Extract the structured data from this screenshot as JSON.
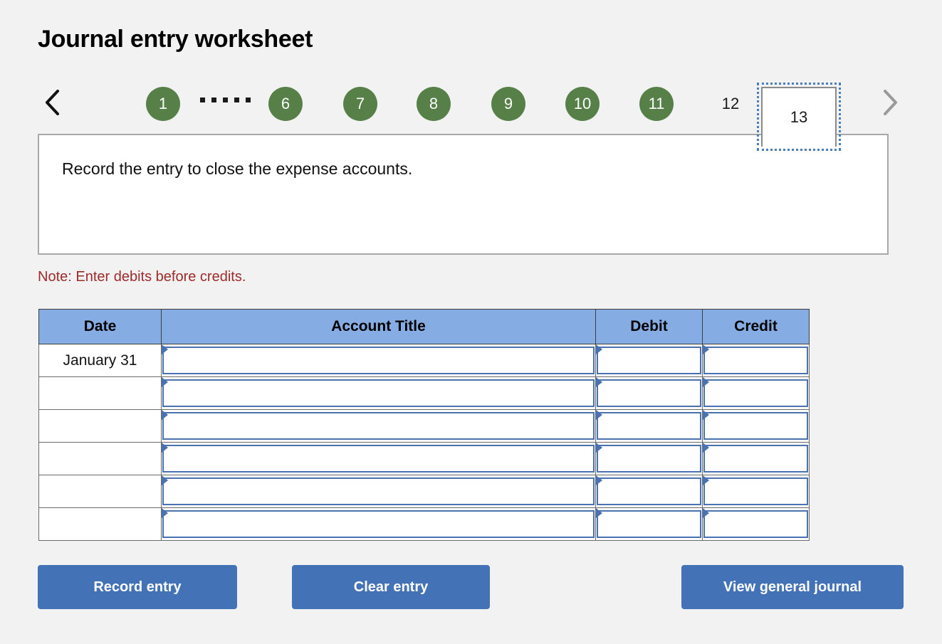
{
  "page_title": "Journal entry worksheet",
  "pager": {
    "prev_icon": "chevron-left-icon",
    "next_icon": "chevron-right-icon",
    "ellipsis_label": ".....",
    "steps": [
      {
        "label": "1",
        "state": "complete"
      },
      {
        "label": "6",
        "state": "complete"
      },
      {
        "label": "7",
        "state": "complete"
      },
      {
        "label": "8",
        "state": "complete"
      },
      {
        "label": "9",
        "state": "complete"
      },
      {
        "label": "10",
        "state": "complete"
      },
      {
        "label": "11",
        "state": "complete"
      },
      {
        "label": "12",
        "state": "plain"
      },
      {
        "label": "13",
        "state": "current"
      }
    ]
  },
  "instruction": "Record the entry to close the expense accounts.",
  "note": "Note: Enter debits before credits.",
  "table": {
    "headers": [
      "Date",
      "Account Title",
      "Debit",
      "Credit"
    ],
    "rows": [
      {
        "date": "January 31",
        "account": "",
        "debit": "",
        "credit": ""
      },
      {
        "date": "",
        "account": "",
        "debit": "",
        "credit": ""
      },
      {
        "date": "",
        "account": "",
        "debit": "",
        "credit": ""
      },
      {
        "date": "",
        "account": "",
        "debit": "",
        "credit": ""
      },
      {
        "date": "",
        "account": "",
        "debit": "",
        "credit": ""
      },
      {
        "date": "",
        "account": "",
        "debit": "",
        "credit": ""
      }
    ]
  },
  "buttons": {
    "record": "Record entry",
    "clear": "Clear entry",
    "view": "View general journal"
  },
  "colors": {
    "step_complete": "#578049",
    "header_blue": "#85ade3",
    "button_blue": "#4372b6",
    "note_red": "#9e2a2a",
    "cell_border_blue": "#4a72b0",
    "focus_ring": "#4a7ebb"
  }
}
